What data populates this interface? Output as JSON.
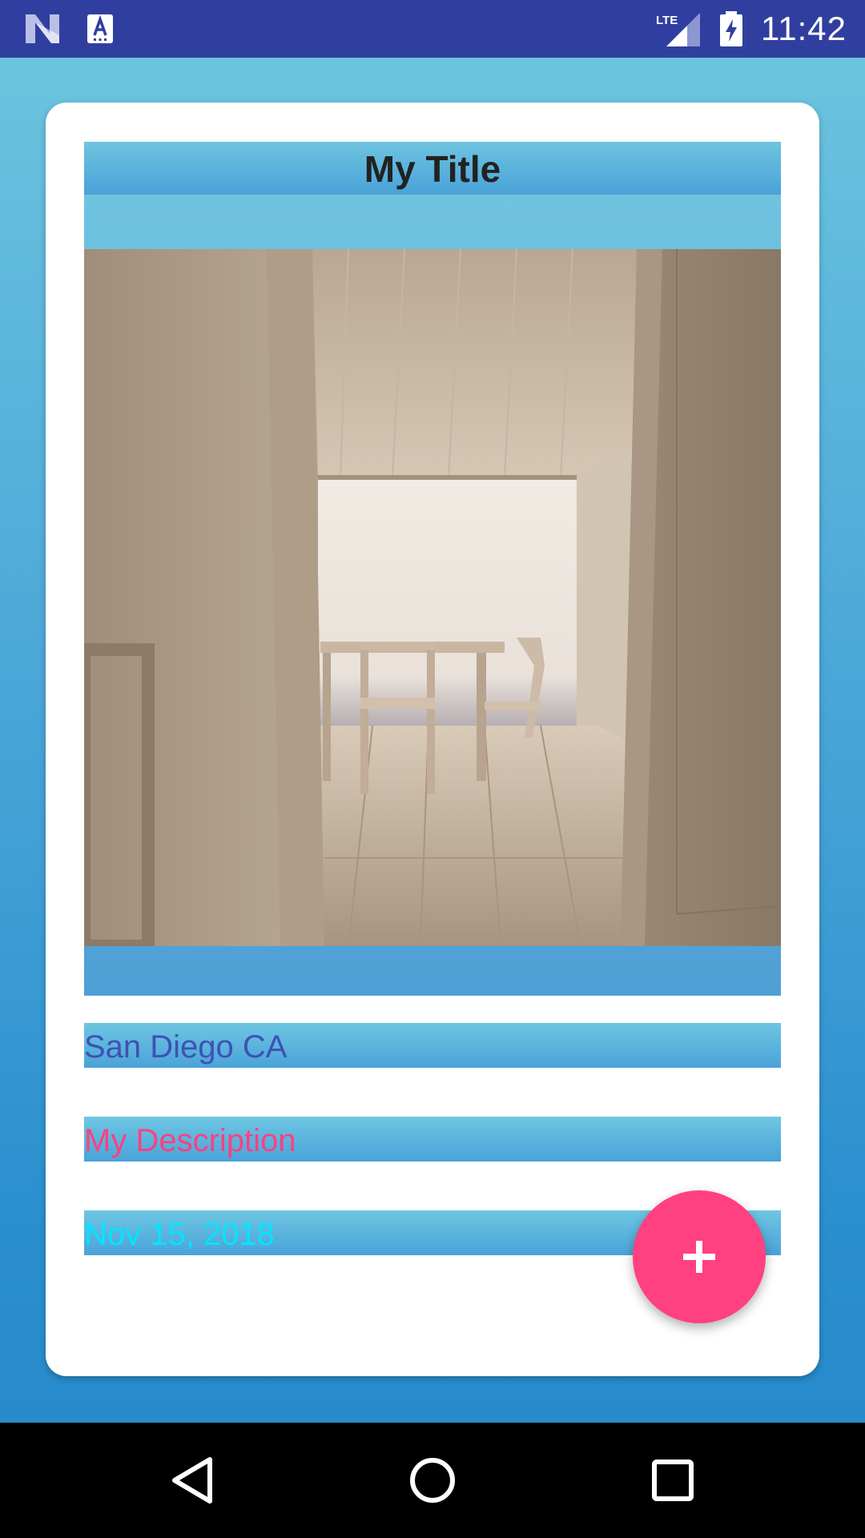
{
  "status_bar": {
    "time": "11:42",
    "network": "LTE",
    "icons": [
      "n-icon",
      "a-keyboard-icon",
      "lte-signal-icon",
      "battery-charging-icon"
    ],
    "background_color": "#303f9f"
  },
  "card": {
    "title": "My Title",
    "image_alt": "Room interior with wooden table and chairs",
    "location": "San Diego CA",
    "description": "My Description",
    "date": "Nov 15, 2018",
    "text_colors": {
      "location": "#3f51b5",
      "description": "#ff4081",
      "date": "#00e5ff"
    }
  },
  "fab": {
    "icon": "plus-icon",
    "color": "#ff4081"
  },
  "nav_bar": {
    "icons": [
      "back-icon",
      "home-icon",
      "recents-icon"
    ]
  }
}
